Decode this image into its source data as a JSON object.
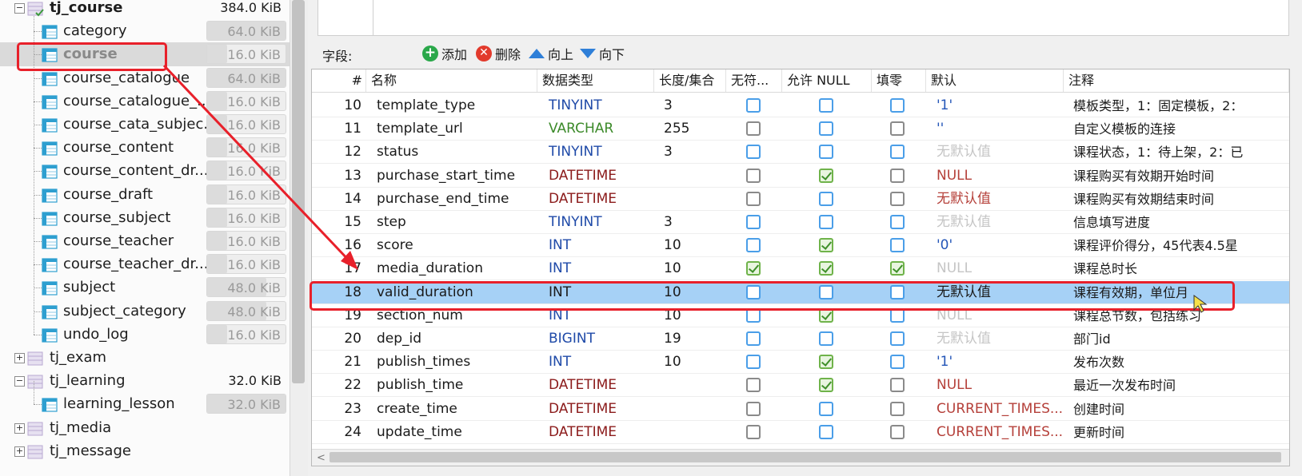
{
  "tree": {
    "databases": [
      {
        "name": "tj_course",
        "size": "384.0 KiB",
        "expanded": true
      },
      {
        "name": "tj_exam",
        "size": "",
        "expanded": false
      },
      {
        "name": "tj_learning",
        "size": "32.0 KiB",
        "expanded": true
      },
      {
        "name": "tj_media",
        "size": "",
        "expanded": false
      },
      {
        "name": "tj_message",
        "size": "",
        "expanded": false
      }
    ],
    "tables": [
      {
        "name": "category",
        "size": "64.0 KiB",
        "fill": 1.0
      },
      {
        "name": "course",
        "size": "16.0 KiB",
        "fill": 0.25
      },
      {
        "name": "course_catalogue",
        "size": "64.0 KiB",
        "fill": 1.0
      },
      {
        "name": "course_catalogue_...",
        "size": "16.0 KiB",
        "fill": 0.25
      },
      {
        "name": "course_cata_subjec...",
        "size": "16.0 KiB",
        "fill": 0.25
      },
      {
        "name": "course_content",
        "size": "16.0 KiB",
        "fill": 0.25
      },
      {
        "name": "course_content_dr...",
        "size": "16.0 KiB",
        "fill": 0.25
      },
      {
        "name": "course_draft",
        "size": "16.0 KiB",
        "fill": 0.25
      },
      {
        "name": "course_subject",
        "size": "16.0 KiB",
        "fill": 0.25
      },
      {
        "name": "course_teacher",
        "size": "16.0 KiB",
        "fill": 0.25
      },
      {
        "name": "course_teacher_dr...",
        "size": "16.0 KiB",
        "fill": 0.25
      },
      {
        "name": "subject",
        "size": "48.0 KiB",
        "fill": 0.75
      },
      {
        "name": "subject_category",
        "size": "48.0 KiB",
        "fill": 0.75
      },
      {
        "name": "undo_log",
        "size": "16.0 KiB",
        "fill": 0.25
      }
    ],
    "learning_tables": [
      {
        "name": "learning_lesson",
        "size": "32.0 KiB",
        "fill": 1.0
      }
    ],
    "selected": "course"
  },
  "toolbar": {
    "field_label": "字段:",
    "add": "添加",
    "delete": "删除",
    "up": "向上",
    "down": "向下"
  },
  "columns": [
    "#",
    "名称",
    "数据类型",
    "长度/集合",
    "无符...",
    "允许 NULL",
    "填零",
    "默认",
    "注释"
  ],
  "rows": [
    {
      "n": "10",
      "name": "template_type",
      "type": "TINYINT",
      "tcls": "t-blue",
      "len": "3",
      "unsigned": "blue",
      "nullable": "blue",
      "zero": "blue",
      "def": "'1'",
      "dcls": "d-blue",
      "comment": "模板类型，1：固定模板，2："
    },
    {
      "n": "11",
      "name": "template_url",
      "type": "VARCHAR",
      "tcls": "t-green",
      "len": "255",
      "unsigned": "grey",
      "nullable": "blue",
      "zero": "grey",
      "def": "''",
      "dcls": "d-blue",
      "comment": "自定义模板的连接"
    },
    {
      "n": "12",
      "name": "status",
      "type": "TINYINT",
      "tcls": "t-blue",
      "len": "3",
      "unsigned": "blue",
      "nullable": "blue",
      "zero": "blue",
      "def": "无默认值",
      "dcls": "d-grey",
      "comment": "课程状态，1：待上架，2：已"
    },
    {
      "n": "13",
      "name": "purchase_start_time",
      "type": "DATETIME",
      "tcls": "t-red",
      "len": "",
      "unsigned": "grey",
      "nullable": "check",
      "zero": "grey",
      "def": "NULL",
      "dcls": "d-red",
      "comment": "课程购买有效期开始时间"
    },
    {
      "n": "14",
      "name": "purchase_end_time",
      "type": "DATETIME",
      "tcls": "t-red",
      "len": "",
      "unsigned": "grey",
      "nullable": "blue",
      "zero": "grey",
      "def": "无默认值",
      "dcls": "d-red",
      "comment": "课程购买有效期结束时间"
    },
    {
      "n": "15",
      "name": "step",
      "type": "TINYINT",
      "tcls": "t-blue",
      "len": "3",
      "unsigned": "blue",
      "nullable": "blue",
      "zero": "blue",
      "def": "无默认值",
      "dcls": "d-grey",
      "comment": "信息填写进度"
    },
    {
      "n": "16",
      "name": "score",
      "type": "INT",
      "tcls": "t-blue",
      "len": "10",
      "unsigned": "blue",
      "nullable": "check",
      "zero": "blue",
      "def": "'0'",
      "dcls": "d-blue",
      "comment": "课程评价得分，45代表4.5星"
    },
    {
      "n": "17",
      "name": "media_duration",
      "type": "INT",
      "tcls": "t-blue",
      "len": "10",
      "unsigned": "check",
      "nullable": "check",
      "zero": "check",
      "def": "NULL",
      "dcls": "d-grey",
      "comment": "课程总时长"
    },
    {
      "n": "18",
      "name": "valid_duration",
      "type": "INT",
      "tcls": "d-black",
      "len": "10",
      "unsigned": "blue",
      "nullable": "blue",
      "zero": "blue",
      "def": "无默认值",
      "dcls": "d-black",
      "comment": "课程有效期，单位月",
      "highlight": true
    },
    {
      "n": "19",
      "name": "section_num",
      "type": "INT",
      "tcls": "t-blue",
      "len": "10",
      "unsigned": "blue",
      "nullable": "check",
      "zero": "blue",
      "def": "NULL",
      "dcls": "d-grey",
      "comment": "课程总节数，包括练习"
    },
    {
      "n": "20",
      "name": "dep_id",
      "type": "BIGINT",
      "tcls": "t-blue",
      "len": "19",
      "unsigned": "blue",
      "nullable": "blue",
      "zero": "blue",
      "def": "无默认值",
      "dcls": "d-grey",
      "comment": "部门id"
    },
    {
      "n": "21",
      "name": "publish_times",
      "type": "INT",
      "tcls": "t-blue",
      "len": "10",
      "unsigned": "blue",
      "nullable": "check",
      "zero": "blue",
      "def": "'1'",
      "dcls": "d-blue",
      "comment": "发布次数"
    },
    {
      "n": "22",
      "name": "publish_time",
      "type": "DATETIME",
      "tcls": "t-red",
      "len": "",
      "unsigned": "grey",
      "nullable": "check",
      "zero": "grey",
      "def": "NULL",
      "dcls": "d-red",
      "comment": "最近一次发布时间"
    },
    {
      "n": "23",
      "name": "create_time",
      "type": "DATETIME",
      "tcls": "t-red",
      "len": "",
      "unsigned": "grey",
      "nullable": "blue",
      "zero": "grey",
      "def": "CURRENT_TIMES...",
      "dcls": "d-red",
      "comment": "创建时间"
    },
    {
      "n": "24",
      "name": "update_time",
      "type": "DATETIME",
      "tcls": "t-red",
      "len": "",
      "unsigned": "grey",
      "nullable": "blue",
      "zero": "grey",
      "def": "CURRENT_TIMES...",
      "dcls": "d-red",
      "comment": "更新时间"
    }
  ],
  "colors": {
    "accent": "#e8202a",
    "highlight": "#a6d1f6",
    "checkbox": "#4a9ee8"
  },
  "icons": {
    "add": "plus-circle-icon",
    "delete": "x-circle-icon",
    "up": "arrow-up-icon",
    "down": "arrow-down-icon",
    "table": "table-icon",
    "database": "database-icon"
  }
}
